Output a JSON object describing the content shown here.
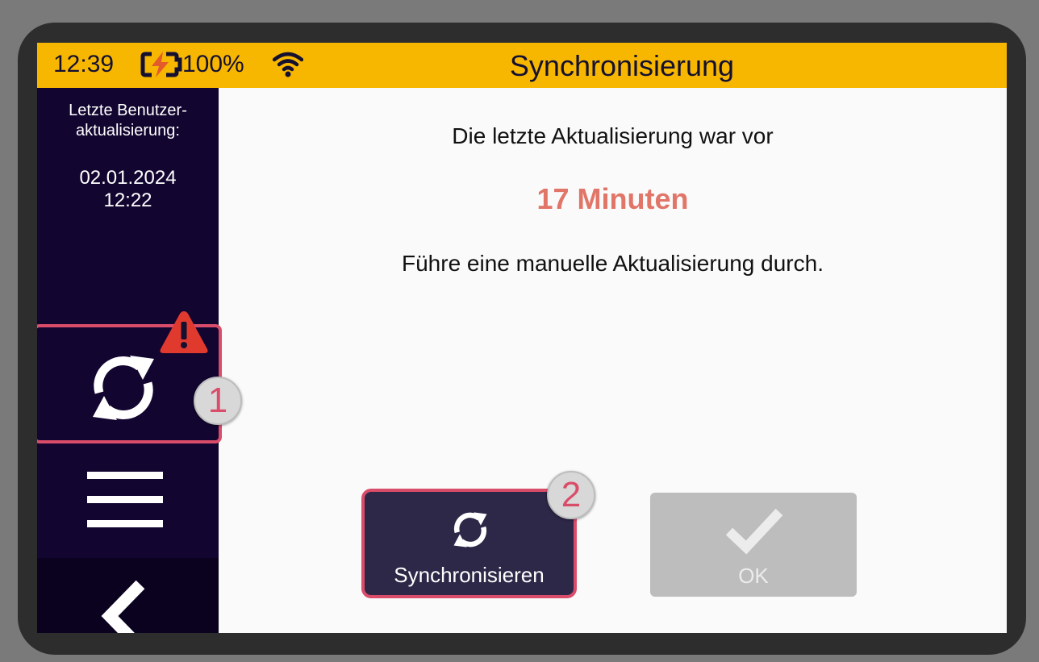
{
  "statusbar": {
    "time": "12:39",
    "battery_percent": "100%",
    "battery_icon": "battery-charging-icon",
    "wifi_icon": "wifi-icon",
    "title": "Synchronisierung"
  },
  "sidebar": {
    "last_update_label_line1": "Letzte Benutzer-",
    "last_update_label_line2": "aktualisierung:",
    "date": "02.01.2024",
    "time": "12:22",
    "sync_icon": "sync-icon",
    "warning_icon": "warning-icon",
    "menu_icon": "menu-icon",
    "back_icon": "back-icon"
  },
  "main": {
    "line1": "Die letzte Aktualisierung war vor",
    "minutes": "17 Minuten",
    "line3": "Führe eine manuelle Aktualisierung durch."
  },
  "buttons": {
    "sync_label": "Synchronisieren",
    "ok_label": "OK"
  },
  "callouts": {
    "one": "1",
    "two": "2"
  },
  "colors": {
    "statusbar_bg": "#f7b700",
    "sidebar_bg": "#120530",
    "highlight": "#d94d6a",
    "minutes_text": "#e17567",
    "sync_button_bg": "#2d2748",
    "ok_button_bg": "#bdbdbd",
    "warning_red": "#e03a2f"
  }
}
